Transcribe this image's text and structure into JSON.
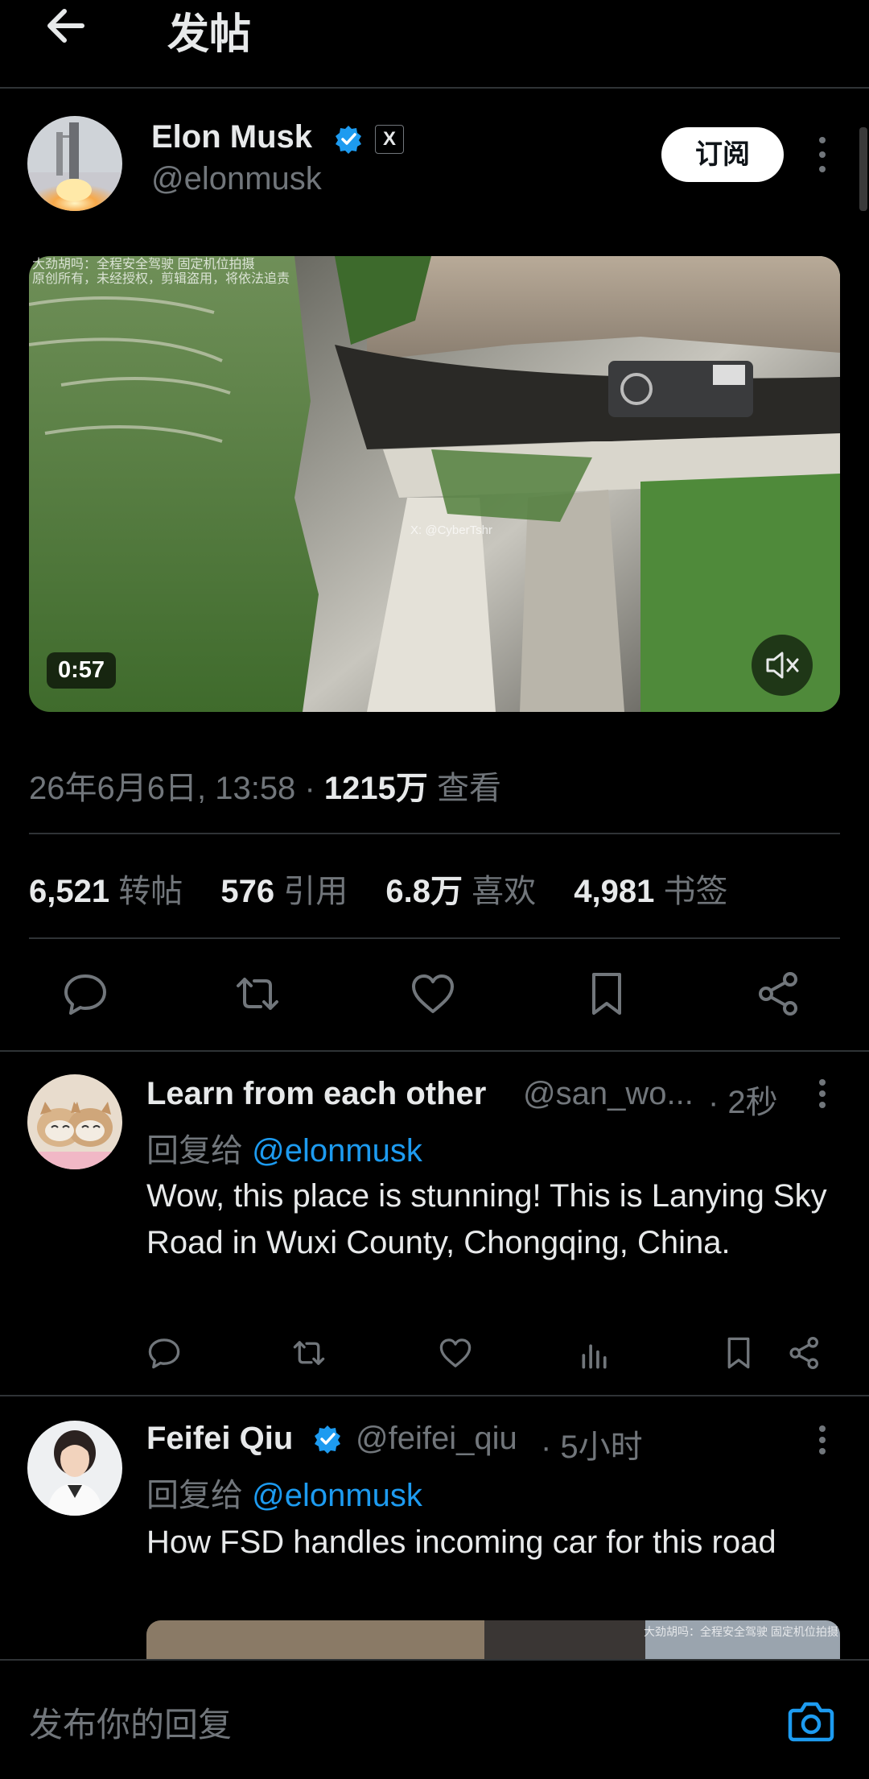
{
  "header": {
    "title": "发帖"
  },
  "post": {
    "author_name": "Elon Musk",
    "author_handle": "@elonmusk",
    "affiliate_badge": "X",
    "subscribe_label": "订阅",
    "video": {
      "duration": "0:57",
      "watermark_line1": "大劲胡吗：全程安全驾驶 固定机位拍摄",
      "watermark_line2": "原创所有，未经授权，剪辑盗用，将依法追责",
      "watermark_center": "X: @CyberTshr"
    },
    "date": "26年6月6日, 13:58",
    "views_count": "1215万",
    "views_label": "查看",
    "stats": [
      {
        "value": "6,521",
        "label": "转帖"
      },
      {
        "value": "576",
        "label": "引用"
      },
      {
        "value": "6.8万",
        "label": "喜欢"
      },
      {
        "value": "4,981",
        "label": "书签"
      }
    ]
  },
  "replies": [
    {
      "name": "Learn from each other",
      "handle": "@san_wo...",
      "time": "· 2秒",
      "reply_prefix": "回复给",
      "reply_to": "@elonmusk",
      "text": "Wow, this place is stunning! This is Lanying Sky Road in Wuxi County, Chongqing, China."
    },
    {
      "name": "Feifei Qiu",
      "handle": "@feifei_qiu",
      "time": "· 5小时",
      "reply_prefix": "回复给",
      "reply_to": "@elonmusk",
      "text": "How FSD handles incoming car for this road",
      "media_watermark": "大劲胡吗：全程安全驾驶 固定机位拍摄"
    }
  ],
  "compose": {
    "placeholder": "发布你的回复"
  },
  "colors": {
    "accent": "#1d9bf0",
    "background": "#000000",
    "muted": "#71767b",
    "divider": "#2f3336"
  }
}
